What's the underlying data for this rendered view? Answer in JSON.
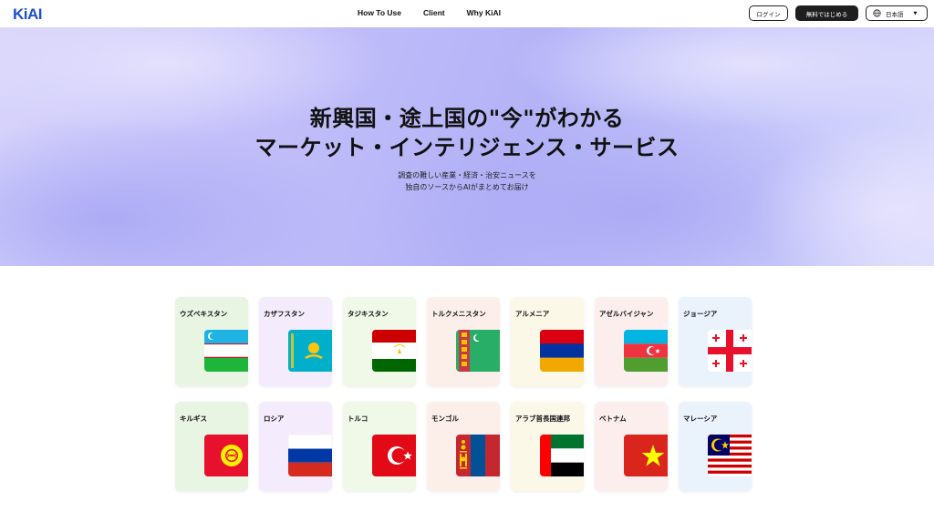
{
  "nav": {
    "logo": "KiAI",
    "menu": [
      "How To Use",
      "Client",
      "Why KiAI"
    ],
    "login": "ログイン",
    "start": "無料ではじめる",
    "language": "日本語",
    "globe_icon": "globe-icon",
    "caret_icon": "chevron-down-icon"
  },
  "hero": {
    "title_line1": "新興国・途上国の\"今\"がわかる",
    "title_line2": "マーケット・インテリジェンス・サービス",
    "sub_line1": "調査の難しい産業・経済・治安ニュースを",
    "sub_line2": "独自のソースからAIがまとめてお届け"
  },
  "countries": [
    {
      "name": "ウズベキスタン",
      "flag": "uzbekistan-flag",
      "bg": "#e8f5e3"
    },
    {
      "name": "カザフスタン",
      "flag": "kazakhstan-flag",
      "bg": "#f4ecfc"
    },
    {
      "name": "タジキスタン",
      "flag": "tajikistan-flag",
      "bg": "#f0f9e8"
    },
    {
      "name": "トルクメニスタン",
      "flag": "turkmenistan-flag",
      "bg": "#fcefe9"
    },
    {
      "name": "アルメニア",
      "flag": "armenia-flag",
      "bg": "#fbf8e8"
    },
    {
      "name": "アゼルバイジャン",
      "flag": "azerbaijan-flag",
      "bg": "#fdeeee"
    },
    {
      "name": "ジョージア",
      "flag": "georgia-flag",
      "bg": "#eaf2fc"
    },
    {
      "name": "キルギス",
      "flag": "kyrgyzstan-flag",
      "bg": "#e8f5e3"
    },
    {
      "name": "ロシア",
      "flag": "russia-flag",
      "bg": "#f4ecfc"
    },
    {
      "name": "トルコ",
      "flag": "turkey-flag",
      "bg": "#f0f9e8"
    },
    {
      "name": "モンゴル",
      "flag": "mongolia-flag",
      "bg": "#fcefe9"
    },
    {
      "name": "アラブ首長国連邦",
      "flag": "uae-flag",
      "bg": "#fbf8e8"
    },
    {
      "name": "ベトナム",
      "flag": "vietnam-flag",
      "bg": "#fdeeee"
    },
    {
      "name": "マレーシア",
      "flag": "malaysia-flag",
      "bg": "#eaf2fc"
    }
  ]
}
